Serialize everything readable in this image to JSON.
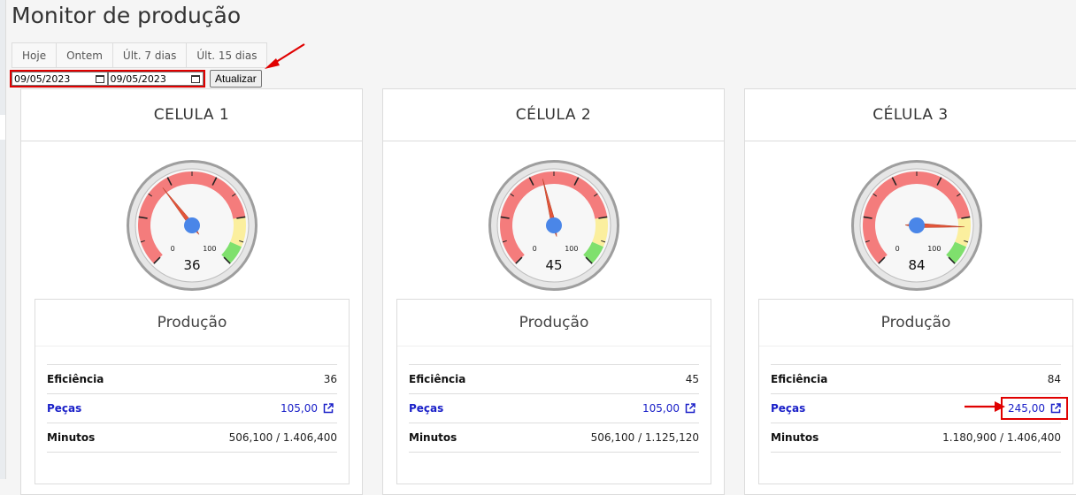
{
  "page": {
    "title": "Monitor de produção"
  },
  "quick_ranges": [
    "Hoje",
    "Ontem",
    "Últ. 7 dias",
    "Últ. 15 dias"
  ],
  "filters": {
    "date_from": "09/05/2023",
    "date_to": "09/05/2023",
    "refresh_label": "Atualizar"
  },
  "section_label": "Produção",
  "labels": {
    "efficiency": "Eficiência",
    "pieces": "Peças",
    "minutes": "Minutos"
  },
  "gauge_scale": {
    "min": "0",
    "max": "100"
  },
  "colors": {
    "gauge_red": "#f47c7c",
    "gauge_yellow": "#fbef9e",
    "gauge_green": "#7fe06d",
    "needle": "#e2553a",
    "hub": "#4a86e8",
    "link": "#1a20c8",
    "annotation": "#e00000"
  },
  "cells": [
    {
      "name": "CELULA 1",
      "gauge_value": "36",
      "efficiency": "36",
      "pieces": "105,00",
      "minutes": "506,100 / 1.406,400"
    },
    {
      "name": "CÉLULA 2",
      "gauge_value": "45",
      "efficiency": "45",
      "pieces": "105,00",
      "minutes": "506,100 / 1.125,120"
    },
    {
      "name": "CÉLULA 3",
      "gauge_value": "84",
      "efficiency": "84",
      "pieces": "245,00",
      "minutes": "1.180,900 / 1.406,400"
    }
  ]
}
